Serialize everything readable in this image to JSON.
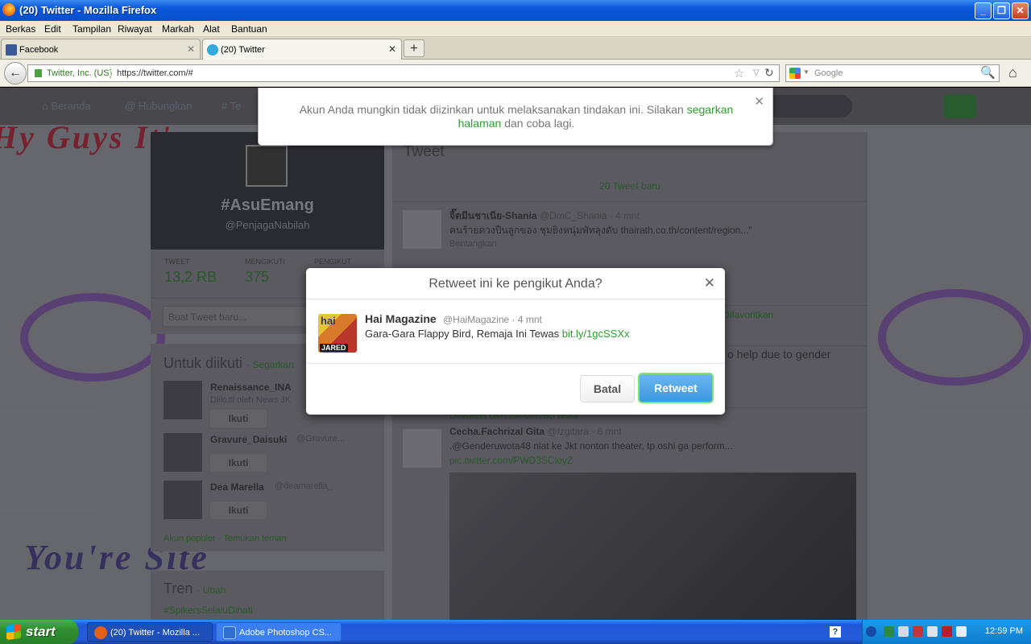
{
  "window": {
    "title": "(20) Twitter - Mozilla Firefox",
    "buttons": [
      "_",
      "❐",
      "✕"
    ]
  },
  "menu": [
    "Berkas",
    "Edit",
    "Tampilan",
    "Riwayat",
    "Markah",
    "Alat",
    "Bantuan"
  ],
  "tabs": [
    {
      "label": "Facebook",
      "close": "✕"
    },
    {
      "label": "(20) Twitter",
      "close": "✕"
    }
  ],
  "newtab": "+",
  "nav": {
    "back": "←",
    "identity": "Twitter, Inc. (US)",
    "url": "https://twitter.com/#",
    "star": "☆",
    "dropdown": "▽",
    "reload": "↻",
    "search_placeholder": "Google",
    "search_icon": "🔍",
    "home": "⌂"
  },
  "twitter_nav": {
    "home": "Beranda",
    "connect": "Hubungkan",
    "discover": "Te"
  },
  "background": {
    "top_text": "Hy Guys It's",
    "bottom_text": "You're Site"
  },
  "profile": {
    "name": "#AsuEmang",
    "handle": "@PenjagaNabilah",
    "tweets_label": "TWEET",
    "tweets_value": "13,2 RB",
    "following_label": "MENGIKUTI",
    "following_value": "375",
    "followers_label": "PENGIKUT",
    "compose_placeholder": "Buat Tweet baru..."
  },
  "who_to_follow": {
    "header": "Untuk diikuti",
    "refresh": "· Segarkan",
    "rows": [
      {
        "name": "Renaissance_INA",
        "handle": "Diikuti oleh News JK",
        "follow": "Ikuti"
      },
      {
        "name": "Gravure_Daisuki",
        "handle": "@Gravure...",
        "follow": "Ikuti"
      },
      {
        "name": "Dea Marella",
        "handle": "@deamarella_",
        "follow": "Ikuti"
      }
    ],
    "footer": "Akun populer · Temukan teman"
  },
  "trends": {
    "header": "Tren",
    "change": "· Ubah",
    "first": "#SpikersSelaluDihati"
  },
  "stream": {
    "header": "Tweet",
    "new_tweets": "20 Tweet baru",
    "tweets": [
      {
        "name": "จิ๊ตมีนชาเนีย-Shania",
        "handle": "@DmC_Shania · 4 mnt",
        "text": "คนร้ายดวงปืนลูกของ ชุมยิงหนุ่มพัทลุงดับ thairath.co.th/content/region...\"",
        "action": "Bentangkan"
      },
      {
        "name": "Cecha.Fachrizal Gita",
        "handle": "@fzgitara · 6 mnt",
        "text": ".@Genderuwota48 niat ke Jkt nonton theater, tp oshi ga perform...",
        "link": "pic.twitter.com/PWD3SCloyZ",
        "retweeted_by": "Diretweet oleh Genderuwo Wota"
      }
    ],
    "favorited": "Difavoritkan",
    "gender_text": "o help due to gender"
  },
  "alert": {
    "text": "Akun Anda mungkin tidak diizinkan untuk melaksanakan tindakan ini. Silakan ",
    "link": "segarkan halaman",
    "text_end": " dan coba lagi.",
    "close": "✕"
  },
  "modal": {
    "title": "Retweet ini ke pengikut Anda?",
    "close": "✕",
    "tweet": {
      "name": "Hai Magazine",
      "handle": "@HaiMagazine · 4 mnt",
      "text": "Gara-Gara Flappy Bird, Remaja Ini Tewas ",
      "link": "bit.ly/1gcSSXx",
      "avatar_label": "JARED",
      "avatar_title": "hai"
    },
    "cancel": "Batal",
    "confirm": "Retweet"
  },
  "taskbar": {
    "start": "start",
    "items": [
      {
        "label": "(20) Twitter - Mozilla ...",
        "color": "#e2611b"
      },
      {
        "label": "Adobe Photoshop CS...",
        "color": "#2f6fd0"
      }
    ],
    "clock": "12:59 PM",
    "help": "?"
  },
  "colors": {
    "link_green": "#2c9e2c",
    "retweet_blue": "#3d97e0",
    "xp_blue": "#245ddb"
  }
}
